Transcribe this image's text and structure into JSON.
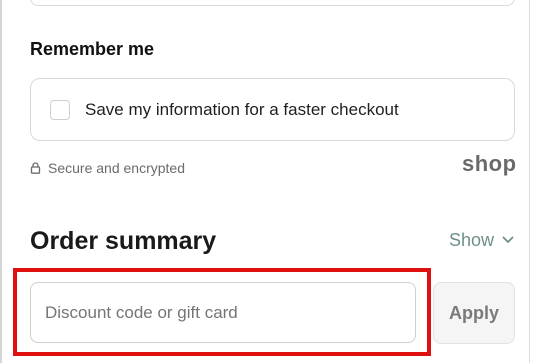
{
  "remember_section": {
    "heading": "Remember me",
    "checkbox_checked": false,
    "checkbox_label": "Save my information for a faster checkout"
  },
  "security": {
    "icon": "lock-icon",
    "text": "Secure and encrypted"
  },
  "brand": {
    "logo_text": "shop"
  },
  "order_summary": {
    "heading": "Order summary",
    "toggle_label": "Show",
    "toggle_icon": "chevron-down-icon"
  },
  "discount": {
    "value": "",
    "placeholder": "Discount code or gift card",
    "apply_label": "Apply"
  },
  "colors": {
    "accent_link": "#6d8f8a",
    "highlight": "#e01010"
  }
}
